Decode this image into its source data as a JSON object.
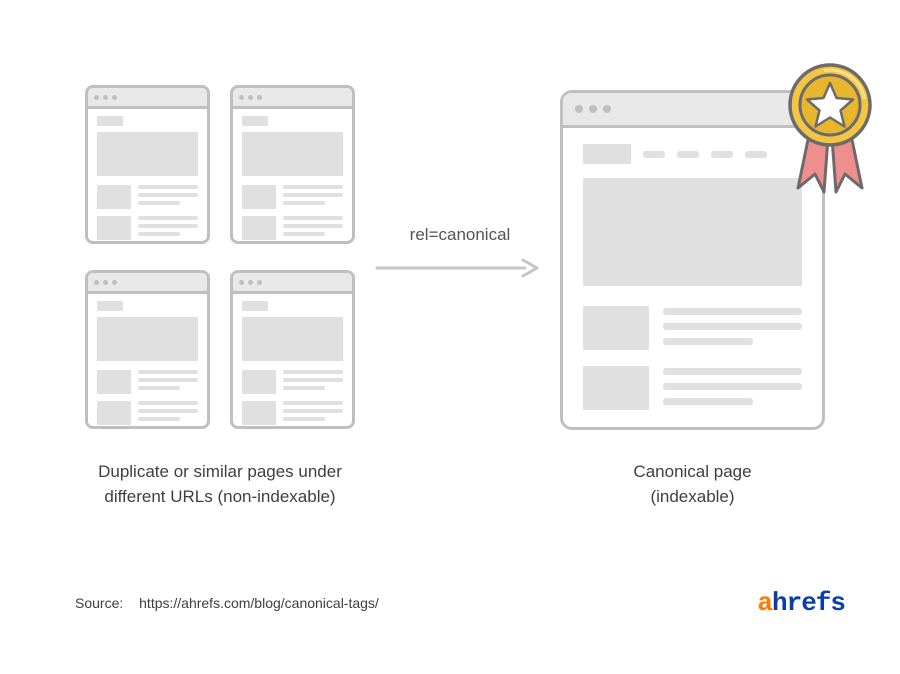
{
  "arrow_label": "rel=canonical",
  "caption_left_line1": "Duplicate or similar pages under",
  "caption_left_line2": "different URLs (non-indexable)",
  "caption_right_line1": "Canonical page",
  "caption_right_line2": "(indexable)",
  "source_label": "Source:",
  "source_url": "https://ahrefs.com/blog/canonical-tags/",
  "logo_prefix": "a",
  "logo_rest": "hrefs"
}
